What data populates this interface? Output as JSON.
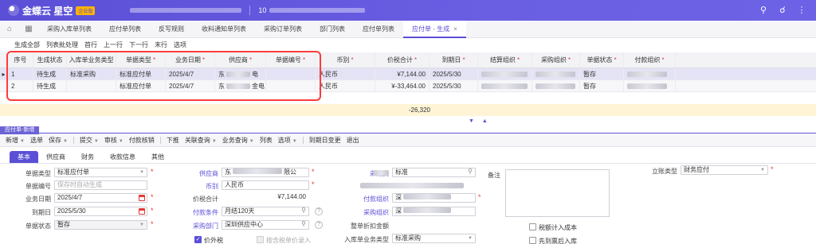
{
  "app": {
    "brand": "金蝶云 星空",
    "edition": "企业版",
    "org_code": "10"
  },
  "tabs": [
    {
      "label": "采购入库单列表"
    },
    {
      "label": "应付单列表"
    },
    {
      "label": "反写规则"
    },
    {
      "label": "收料通知单列表"
    },
    {
      "label": "采购订单列表"
    },
    {
      "label": "部门列表"
    },
    {
      "label": "应付单列表"
    },
    {
      "label": "应付单 - 生成",
      "active": true,
      "close": "×"
    }
  ],
  "list_toolbar": [
    "生成全部",
    "列表批处理",
    "首行",
    "上一行",
    "下一行",
    "末行",
    "选项"
  ],
  "grid": {
    "headers": [
      "序号",
      "生成状态",
      "入库单业务类型",
      "单据类型",
      "业务日期",
      "供应商",
      "单据编号",
      "币别",
      "价税合计",
      "到期日",
      "结算组织",
      "采购组织",
      "单据状态",
      "付款组织"
    ],
    "required": [
      false,
      false,
      false,
      true,
      true,
      true,
      true,
      true,
      true,
      true,
      true,
      true,
      true,
      true
    ],
    "rows": [
      {
        "marker": "▸",
        "seq": "1",
        "status": "待生成",
        "biz_type": "标准采购",
        "doc_type": "标准应付单",
        "date": "2025/4/7",
        "supplier_a": "东",
        "supplier_b": "电",
        "currency": "人民币",
        "amount": "¥7,144.00",
        "due": "2025/5/30",
        "doc_status": "暂存"
      },
      {
        "marker": "",
        "seq": "2",
        "status": "待生成",
        "biz_type": "",
        "doc_type": "标准应付单",
        "date": "2025/4/7",
        "supplier_a": "东",
        "supplier_b": "金电",
        "currency": "人民币",
        "amount": "¥-33,464.00",
        "due": "2025/5/30",
        "doc_status": "暂存"
      }
    ],
    "total": "-26,320"
  },
  "sub_panel": {
    "tab": "应付单-新增",
    "toolbar": [
      {
        "label": "新增",
        "caret": true
      },
      {
        "label": "选单"
      },
      {
        "label": "保存",
        "caret": true
      },
      {
        "label": "提交",
        "caret": true
      },
      {
        "label": "审核",
        "caret": true,
        "disabled": true
      },
      {
        "label": "付款核销",
        "disabled": true
      },
      {
        "label": "下推"
      },
      {
        "label": "关联查询",
        "caret": true
      },
      {
        "label": "业务查询",
        "caret": true
      },
      {
        "label": "列表"
      },
      {
        "label": "选项",
        "caret": true
      },
      {
        "label": "到期日变更"
      },
      {
        "label": "退出"
      }
    ],
    "form_tabs": [
      "基本",
      "供应商",
      "财务",
      "收款信息",
      "其他"
    ]
  },
  "form": {
    "doc_type_label": "单据类型",
    "doc_type_value": "标准应付单",
    "doc_no_label": "单据编号",
    "doc_no_placeholder": "保存时自动生成",
    "biz_date_label": "业务日期",
    "biz_date_value": "2025/4/7",
    "due_date_label": "到期日",
    "due_date_value": "2025/5/30",
    "doc_status_label": "单据状态",
    "doc_status_value": "暂存",
    "supplier_label": "供应商",
    "supplier_value_a": "东",
    "supplier_value_b": "限公",
    "currency_label": "币别",
    "currency_value": "人民币",
    "total_label": "价税合计",
    "total_value": "¥7,144.00",
    "pay_terms_label": "付款条件",
    "pay_terms_value": "月结120天",
    "purchase_dept_label": "采购部门",
    "purchase_dept_value": "深圳供应中心",
    "tax_excl_label": "价外税",
    "by_tax_price_label": "按含税单价录入",
    "purchaser_label": "采购员",
    "purchaser_value": "标准",
    "pay_org_label": "付款组织",
    "pay_org_value": "深",
    "purchase_org_label": "采购组织",
    "purchase_org_value": "深",
    "discount_label": "整单折扣金额",
    "inbound_biz_type_label": "入库单业务类型",
    "inbound_biz_type_value": "标准采购",
    "remark_label": "备注",
    "tax_cost_label": "税额计入成本",
    "ticket_first_label": "先到票后入库",
    "account_type_label": "立账类型",
    "account_type_value": "财务应付"
  }
}
